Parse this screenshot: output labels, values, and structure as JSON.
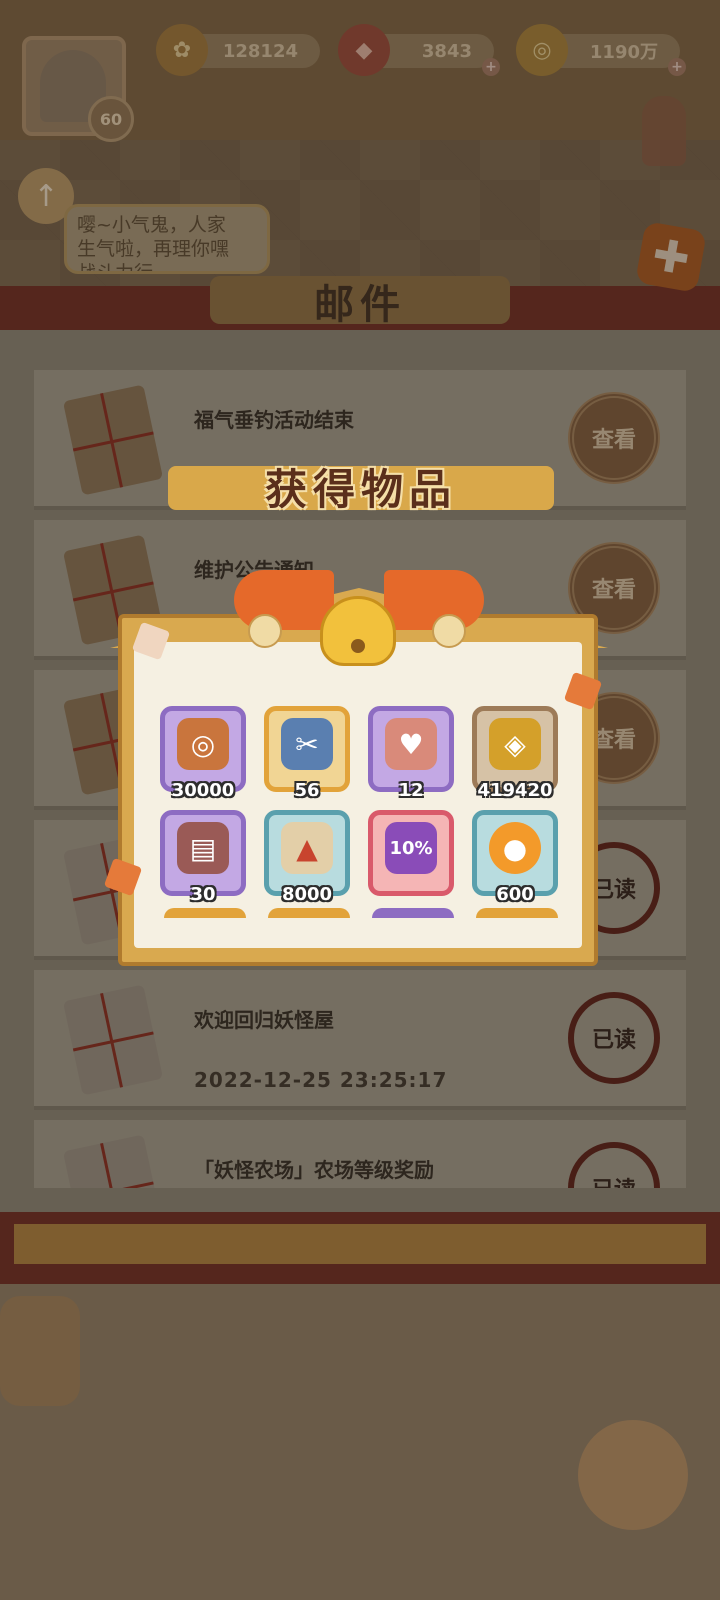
{
  "hud": {
    "level": "60",
    "resources": [
      {
        "icon": "flower-currency-icon",
        "value": "128124"
      },
      {
        "icon": "red-gem-icon",
        "value": "3843"
      },
      {
        "icon": "coin-icon",
        "value": "1190万"
      }
    ]
  },
  "chat_bubble": {
    "text": "嘤~小气鬼，人家\n生气啦，再理你嘿\n战斗力行..."
  },
  "mail_panel": {
    "title": "邮件",
    "items": [
      {
        "title": "福气垂钓活动结束",
        "date": "",
        "button": "查看",
        "read": false
      },
      {
        "title": "维护公告通知",
        "date": "",
        "button": "查看",
        "read": false
      },
      {
        "title": "",
        "date": "",
        "button": "查看",
        "read": false
      },
      {
        "title": "",
        "date": "",
        "button": "已读",
        "read": true
      },
      {
        "title": "欢迎回归妖怪屋",
        "date": "2022-12-25 23:25:17",
        "button": "已读",
        "read": true
      },
      {
        "title": "「妖怪农场」农场等级奖励",
        "date": "",
        "button": "已读",
        "read": true
      }
    ]
  },
  "reward_popup": {
    "title": "获得物品",
    "items": [
      {
        "name": "copper-coin-item",
        "count": "30000",
        "slot": "purple",
        "color": "#c9753d",
        "glyph": "◎"
      },
      {
        "name": "fishing-lure-item",
        "count": "56",
        "slot": "gold",
        "color": "#5a7fb0",
        "glyph": "✂"
      },
      {
        "name": "milk-carton-item",
        "count": "12",
        "slot": "purple",
        "color": "#d98a7a",
        "glyph": "♥"
      },
      {
        "name": "gold-coins-item",
        "count": "419420",
        "slot": "brown",
        "color": "#d4a02a",
        "glyph": "◈"
      },
      {
        "name": "gift-chest-item",
        "count": "30",
        "slot": "purple",
        "color": "#9a5a56",
        "glyph": "▤"
      },
      {
        "name": "like-card-item",
        "count": "8000",
        "slot": "teal",
        "color": "#e3cfa8",
        "glyph": "👍"
      },
      {
        "name": "discount-ticket-item",
        "count": "10%",
        "slot": "red",
        "color": "#8a4cb8",
        "glyph": "%"
      },
      {
        "name": "flame-orb-item",
        "count": "600",
        "slot": "teal",
        "color": "#f39a2a",
        "glyph": "●"
      }
    ]
  }
}
